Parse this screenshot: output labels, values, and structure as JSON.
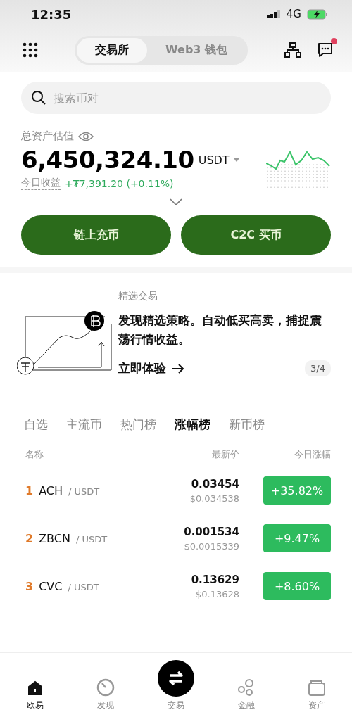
{
  "status_bar": {
    "time": "12:35",
    "network": "4G"
  },
  "header": {
    "tabs": [
      {
        "label": "交易所",
        "selected": true
      },
      {
        "label": "Web3 钱包",
        "selected": false
      }
    ],
    "messages_unread": true
  },
  "search": {
    "placeholder": "搜索币对"
  },
  "assets": {
    "label": "总资产估值",
    "amount": "6,450,324.10",
    "currency": "USDT",
    "earnings_label": "今日收益",
    "earnings": "+₮7,391.20 (+0.11%)"
  },
  "actions": [
    "链上充币",
    "C2C 买币"
  ],
  "promo": {
    "category": "精选交易",
    "text": "发现精选策略。自动低买高卖，捕捉震荡行情收益。",
    "link": "立即体验",
    "pager": "3/4"
  },
  "market": {
    "tabs": [
      {
        "label": "自选",
        "selected": false
      },
      {
        "label": "主流币",
        "selected": false
      },
      {
        "label": "热门榜",
        "selected": false
      },
      {
        "label": "涨幅榜",
        "selected": true
      },
      {
        "label": "新币榜",
        "selected": false
      }
    ],
    "columns": [
      "名称",
      "最新价",
      "今日涨幅"
    ],
    "rows": [
      {
        "rank": "1",
        "base": "ACH",
        "quote": "/ USDT",
        "price": "0.03454",
        "usd_price": "$0.034538",
        "change": "+35.82%"
      },
      {
        "rank": "2",
        "base": "ZBCN",
        "quote": "/ USDT",
        "price": "0.001534",
        "usd_price": "$0.0015339",
        "change": "+9.47%"
      },
      {
        "rank": "3",
        "base": "CVC",
        "quote": "/ USDT",
        "price": "0.13629",
        "usd_price": "$0.13628",
        "change": "+8.60%"
      }
    ]
  },
  "nav": [
    {
      "label": "欧易",
      "kind": "home",
      "selected": true
    },
    {
      "label": "发现",
      "kind": "discover",
      "selected": false
    },
    {
      "label": "交易",
      "kind": "swap",
      "selected": false
    },
    {
      "label": "金融",
      "kind": "circles",
      "selected": false
    },
    {
      "label": "资产",
      "kind": "wallet",
      "selected": false
    }
  ]
}
